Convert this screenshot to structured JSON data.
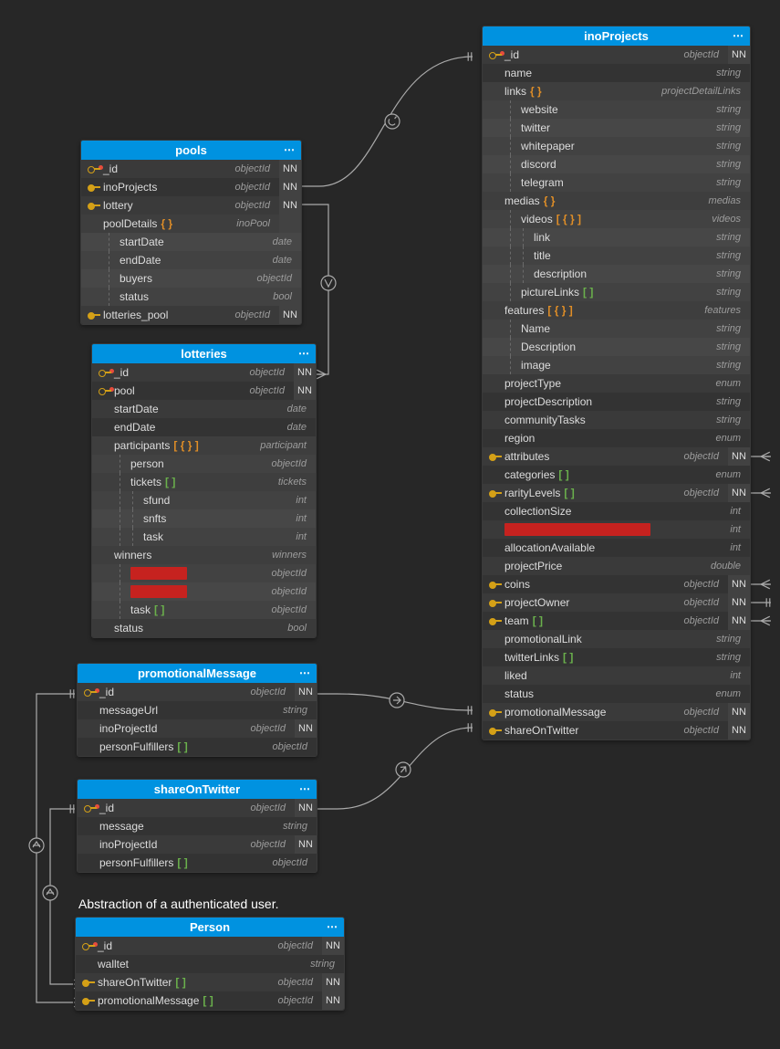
{
  "tables": {
    "pools": {
      "title": "pools",
      "rows": [
        {
          "icon": "pk",
          "name": "_id",
          "type": "objectId",
          "nn": "NN"
        },
        {
          "icon": "fk",
          "name": "inoProjects",
          "type": "objectId",
          "nn": "NN"
        },
        {
          "icon": "fk",
          "name": "lottery",
          "type": "objectId",
          "nn": "NN"
        },
        {
          "icon": "",
          "name": "poolDetails",
          "brace": "{ }",
          "type": "inoPool",
          "nn": "",
          "header": true
        },
        {
          "indent": 1,
          "name": "startDate",
          "type": "date"
        },
        {
          "indent": 1,
          "name": "endDate",
          "type": "date"
        },
        {
          "indent": 1,
          "name": "buyers",
          "type": "objectId"
        },
        {
          "indent": 1,
          "name": "status",
          "type": "bool"
        },
        {
          "icon": "fk",
          "name": "lotteries_pool",
          "type": "objectId",
          "nn": "NN"
        }
      ]
    },
    "lotteries": {
      "title": "lotteries",
      "rows": [
        {
          "icon": "pk",
          "name": "_id",
          "type": "objectId",
          "nn": "NN"
        },
        {
          "icon": "pk",
          "name": "pool",
          "type": "objectId",
          "nn": "NN"
        },
        {
          "name": "startDate",
          "type": "date"
        },
        {
          "name": "endDate",
          "type": "date"
        },
        {
          "name": "participants",
          "bracket_obj": "[ { } ]",
          "type": "participant",
          "header": true
        },
        {
          "indent": 1,
          "name": "person",
          "type": "objectId"
        },
        {
          "indent": 1,
          "name": "tickets",
          "bracket_arr": "[ ]",
          "type": "tickets",
          "header": true
        },
        {
          "indent": 2,
          "name": "sfund",
          "type": "int"
        },
        {
          "indent": 2,
          "name": "snfts",
          "type": "int"
        },
        {
          "indent": 2,
          "name": "task",
          "type": "int"
        },
        {
          "name": "winners",
          "type": "winners",
          "header": true
        },
        {
          "indent": 1,
          "redacted": 62,
          "type": "objectId"
        },
        {
          "indent": 1,
          "redacted": 62,
          "type": "objectId"
        },
        {
          "indent": 1,
          "name": "task",
          "bracket_arr": "[ ]",
          "type": "objectId"
        },
        {
          "name": "status",
          "type": "bool"
        }
      ]
    },
    "promotionalMessage": {
      "title": "promotionalMessage",
      "rows": [
        {
          "icon": "pk",
          "name": "_id",
          "type": "objectId",
          "nn": "NN"
        },
        {
          "name": "messageUrl",
          "type": "string"
        },
        {
          "name": "inoProjectId",
          "type": "objectId",
          "nn": "NN"
        },
        {
          "name": "personFulfillers",
          "bracket_arr": "[ ]",
          "type": "objectId"
        }
      ]
    },
    "shareOnTwitter": {
      "title": "shareOnTwitter",
      "rows": [
        {
          "icon": "pk",
          "name": "_id",
          "type": "objectId",
          "nn": "NN"
        },
        {
          "name": "message",
          "type": "string"
        },
        {
          "name": "inoProjectId",
          "type": "objectId",
          "nn": "NN"
        },
        {
          "name": "personFulfillers",
          "bracket_arr": "[ ]",
          "type": "objectId"
        }
      ]
    },
    "Person": {
      "title": "Person",
      "rows": [
        {
          "icon": "pk",
          "name": "_id",
          "type": "objectId",
          "nn": "NN"
        },
        {
          "name": "walltet",
          "type": "string"
        },
        {
          "icon": "fk",
          "name": "shareOnTwitter",
          "bracket_arr": "[ ]",
          "type": "objectId",
          "nn": "NN"
        },
        {
          "icon": "fk",
          "name": "promotionalMessage",
          "bracket_arr": "[ ]",
          "type": "objectId",
          "nn": "NN"
        }
      ]
    },
    "inoProjects": {
      "title": "inoProjects",
      "rows": [
        {
          "icon": "pk",
          "name": "_id",
          "type": "objectId",
          "nn": "NN"
        },
        {
          "name": "name",
          "type": "string"
        },
        {
          "name": "links",
          "brace": "{ }",
          "type": "projectDetailLinks",
          "header": true
        },
        {
          "indent": 1,
          "name": "website",
          "type": "string"
        },
        {
          "indent": 1,
          "name": "twitter",
          "type": "string"
        },
        {
          "indent": 1,
          "name": "whitepaper",
          "type": "string"
        },
        {
          "indent": 1,
          "name": "discord",
          "type": "string"
        },
        {
          "indent": 1,
          "name": "telegram",
          "type": "string"
        },
        {
          "name": "medias",
          "brace": "{ }",
          "type": "medias",
          "header": true
        },
        {
          "indent": 1,
          "name": "videos",
          "bracket_obj": "[ { } ]",
          "type": "videos",
          "header": true
        },
        {
          "indent": 2,
          "name": "link",
          "type": "string"
        },
        {
          "indent": 2,
          "name": "title",
          "type": "string"
        },
        {
          "indent": 2,
          "name": "description",
          "type": "string"
        },
        {
          "indent": 1,
          "name": "pictureLinks",
          "bracket_arr": "[ ]",
          "type": "string"
        },
        {
          "name": "features",
          "bracket_obj": "[ { } ]",
          "type": "features",
          "header": true
        },
        {
          "indent": 1,
          "name": "Name",
          "type": "string"
        },
        {
          "indent": 1,
          "name": "Description",
          "type": "string"
        },
        {
          "indent": 1,
          "name": "image",
          "type": "string"
        },
        {
          "name": "projectType",
          "type": "enum"
        },
        {
          "name": "projectDescription",
          "type": "string"
        },
        {
          "name": "communityTasks",
          "type": "string"
        },
        {
          "name": "region",
          "type": "enum"
        },
        {
          "icon": "fk",
          "name": "attributes",
          "type": "objectId",
          "nn": "NN"
        },
        {
          "name": "categories",
          "bracket_arr": "[ ]",
          "type": "enum"
        },
        {
          "icon": "fk",
          "name": "rarityLevels",
          "bracket_arr": "[ ]",
          "type": "objectId",
          "nn": "NN"
        },
        {
          "name": "collectionSize",
          "type": "int"
        },
        {
          "redacted": 160,
          "type": "int"
        },
        {
          "name": "allocationAvailable",
          "type": "int"
        },
        {
          "name": "projectPrice",
          "type": "double"
        },
        {
          "icon": "fk",
          "name": "coins",
          "type": "objectId",
          "nn": "NN"
        },
        {
          "icon": "fk",
          "name": "projectOwner",
          "type": "objectId",
          "nn": "NN"
        },
        {
          "icon": "fk",
          "name": "team",
          "bracket_arr": "[ ]",
          "type": "objectId",
          "nn": "NN"
        },
        {
          "name": "promotionalLink",
          "type": "string"
        },
        {
          "name": "twitterLinks",
          "bracket_arr": "[ ]",
          "type": "string"
        },
        {
          "name": "liked",
          "type": "int"
        },
        {
          "name": "status",
          "type": "enum"
        },
        {
          "icon": "fk",
          "name": "promotionalMessage",
          "type": "objectId",
          "nn": "NN"
        },
        {
          "icon": "fk",
          "name": "shareOnTwitter",
          "type": "objectId",
          "nn": "NN"
        }
      ]
    }
  },
  "comment": "Abstraction of a authenticated user."
}
